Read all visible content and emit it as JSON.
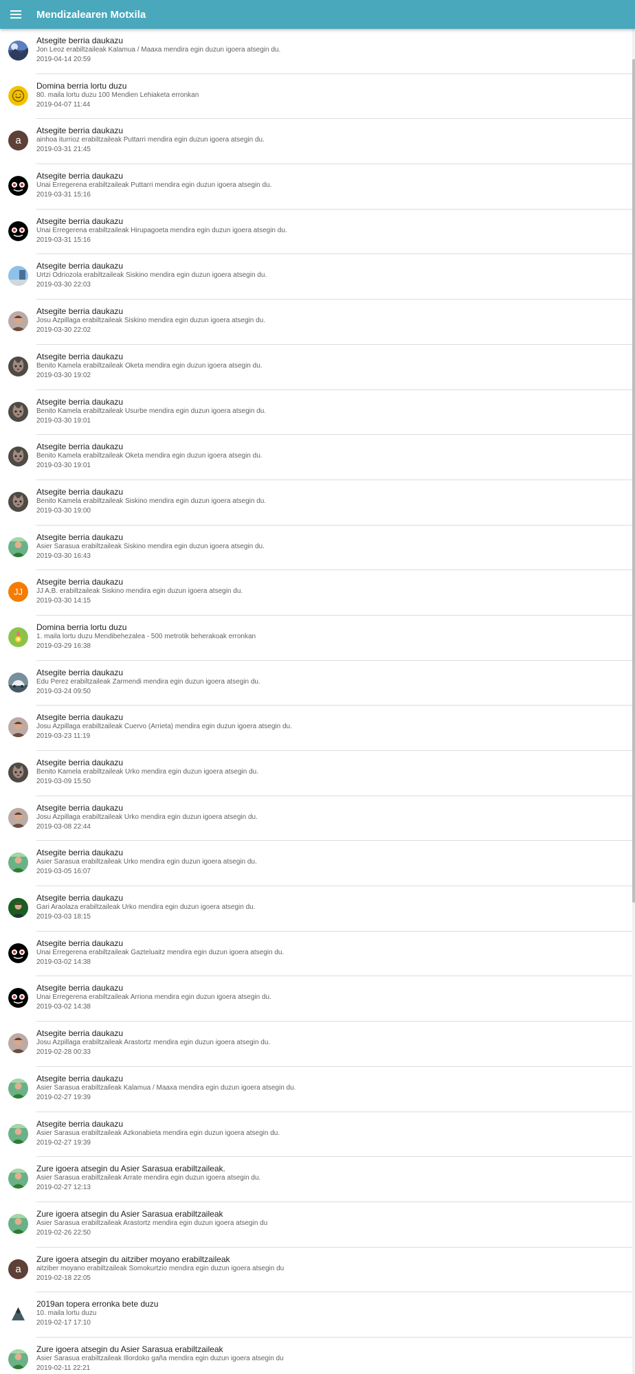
{
  "app": {
    "title": "Mendizalearen Motxila",
    "menu_icon": "hamburger-menu-icon",
    "header_color": "#4aa8bd"
  },
  "notifications": [
    {
      "title": "Atsegite berria daukazu",
      "desc": "Jon Leoz erabiltzaileak Kalamua / Maaxa mendira egin duzun igoera atsegin du.",
      "date": "2019-04-14 20:59",
      "avatar": "landscape-photo-avatar-icon"
    },
    {
      "title": "Domina berria lortu duzu",
      "desc": "80. maila lortu duzu 100 Mendien Lehiaketa erronkan",
      "date": "2019-04-07 11:44",
      "avatar": "medal-gold-icon"
    },
    {
      "title": "Atsegite berria daukazu",
      "desc": "ainhoa iturrioz erabiltzaileak Puttarri mendira egin duzun igoera atsegin du.",
      "date": "2019-03-31 21:45",
      "avatar": "letter-avatar-icon",
      "avatar_letter": "a",
      "avatar_color": "#5d4037"
    },
    {
      "title": "Atsegite berria daukazu",
      "desc": "Unai Erregerena erabiltzaileak Puttarri mendira egin duzun igoera atsegin du.",
      "date": "2019-03-31 15:16",
      "avatar": "cartoon-photo-avatar-icon"
    },
    {
      "title": "Atsegite berria daukazu",
      "desc": "Unai Erregerena erabiltzaileak Hirupagoeta mendira egin duzun igoera atsegin du.",
      "date": "2019-03-31 15:16",
      "avatar": "cartoon-photo-avatar-icon"
    },
    {
      "title": "Atsegite berria daukazu",
      "desc": "Urtzi Odriozola erabiltzaileak Siskino mendira egin duzun igoera atsegin du.",
      "date": "2019-03-30 22:03",
      "avatar": "sky-photo-avatar-icon"
    },
    {
      "title": "Atsegite berria daukazu",
      "desc": "Josu Azpillaga erabiltzaileak Siskino mendira egin duzun igoera atsegin du.",
      "date": "2019-03-30 22:02",
      "avatar": "person-photo-avatar-icon"
    },
    {
      "title": "Atsegite berria daukazu",
      "desc": "Benito Kamela erabiltzaileak Oketa mendira egin duzun igoera atsegin du.",
      "date": "2019-03-30 19:02",
      "avatar": "cat-photo-avatar-icon"
    },
    {
      "title": "Atsegite berria daukazu",
      "desc": "Benito Kamela erabiltzaileak Usurbe mendira egin duzun igoera atsegin du.",
      "date": "2019-03-30 19:01",
      "avatar": "cat-photo-avatar-icon"
    },
    {
      "title": "Atsegite berria daukazu",
      "desc": "Benito Kamela erabiltzaileak Oketa mendira egin duzun igoera atsegin du.",
      "date": "2019-03-30 19:01",
      "avatar": "cat-photo-avatar-icon"
    },
    {
      "title": "Atsegite berria daukazu",
      "desc": "Benito Kamela erabiltzaileak Siskino mendira egin duzun igoera atsegin du.",
      "date": "2019-03-30 19:00",
      "avatar": "cat-photo-avatar-icon"
    },
    {
      "title": "Atsegite berria daukazu",
      "desc": "Asier Sarasua erabiltzaileak Siskino mendira egin duzun igoera atsegin du.",
      "date": "2019-03-30 16:43",
      "avatar": "outdoor-person-avatar-icon"
    },
    {
      "title": "Atsegite berria daukazu",
      "desc": "JJ A.B. erabiltzaileak Siskino mendira egin duzun igoera atsegin du.",
      "date": "2019-03-30 14:15",
      "avatar": "letter-avatar-icon",
      "avatar_letter": "JJ",
      "avatar_color": "#f57c00"
    },
    {
      "title": "Domina berria lortu duzu",
      "desc": "1. maila lortu duzu Mendibehezalea - 500 metrotik beherakoak erronkan",
      "date": "2019-03-29 16:38",
      "avatar": "medal-green-icon"
    },
    {
      "title": "Atsegite berria daukazu",
      "desc": "Edu Perez erabiltzaileak Zarmendi mendira egin duzun igoera atsegin du.",
      "date": "2019-03-24 09:50",
      "avatar": "car-photo-avatar-icon"
    },
    {
      "title": "Atsegite berria daukazu",
      "desc": "Josu Azpillaga erabiltzaileak Cuervo (Arrieta) mendira egin duzun igoera atsegin du.",
      "date": "2019-03-23 11:19",
      "avatar": "person-photo-avatar-icon"
    },
    {
      "title": "Atsegite berria daukazu",
      "desc": "Benito Kamela erabiltzaileak Urko mendira egin duzun igoera atsegin du.",
      "date": "2019-03-09 15:50",
      "avatar": "cat-photo-avatar-icon"
    },
    {
      "title": "Atsegite berria daukazu",
      "desc": "Josu Azpillaga erabiltzaileak Urko mendira egin duzun igoera atsegin du.",
      "date": "2019-03-08 22:44",
      "avatar": "person-photo-avatar-icon"
    },
    {
      "title": "Atsegite berria daukazu",
      "desc": "Asier Sarasua erabiltzaileak Urko mendira egin duzun igoera atsegin du.",
      "date": "2019-03-05 16:07",
      "avatar": "outdoor-person-avatar-icon"
    },
    {
      "title": "Atsegite berria daukazu",
      "desc": "Gari Araolaza erabiltzaileak Urko mendira egin duzun igoera atsegin du.",
      "date": "2019-03-03 18:15",
      "avatar": "forest-person-avatar-icon"
    },
    {
      "title": "Atsegite berria daukazu",
      "desc": "Unai Erregerena erabiltzaileak Gazteluaitz mendira egin duzun igoera atsegin du.",
      "date": "2019-03-02 14:38",
      "avatar": "cartoon-photo-avatar-icon"
    },
    {
      "title": "Atsegite berria daukazu",
      "desc": "Unai Erregerena erabiltzaileak Arriona mendira egin duzun igoera atsegin du.",
      "date": "2019-03-02 14:38",
      "avatar": "cartoon-photo-avatar-icon"
    },
    {
      "title": "Atsegite berria daukazu",
      "desc": "Josu Azpillaga erabiltzaileak Arastortz mendira egin duzun igoera atsegin du.",
      "date": "2019-02-28 00:33",
      "avatar": "person-photo-avatar-icon"
    },
    {
      "title": "Atsegite berria daukazu",
      "desc": "Asier Sarasua erabiltzaileak Kalamua / Maaxa mendira egin duzun igoera atsegin du.",
      "date": "2019-02-27 19:39",
      "avatar": "outdoor-person-avatar-icon"
    },
    {
      "title": "Atsegite berria daukazu",
      "desc": "Asier Sarasua erabiltzaileak Azkonabieta mendira egin duzun igoera atsegin du.",
      "date": "2019-02-27 19:39",
      "avatar": "outdoor-person-avatar-icon"
    },
    {
      "title": "Zure igoera atsegin du Asier Sarasua erabiltzaileak.",
      "desc": "Asier Sarasua erabiltzaileak Arrate mendira egin duzun igoera atsegin du.",
      "date": "2019-02-27 12:13",
      "avatar": "outdoor-person-avatar-icon"
    },
    {
      "title": "Zure igoera atsegin du Asier Sarasua erabiltzaileak",
      "desc": "Asier Sarasua erabiltzaileak Arastortz mendira egin duzun igoera atsegin du",
      "date": "2019-02-26 22:50",
      "avatar": "outdoor-person-avatar-icon"
    },
    {
      "title": "Zure igoera atsegin du aitziber moyano erabiltzaileak",
      "desc": "aitziber moyano erabiltzaileak Somokurtzio mendira egin duzun igoera atsegin du",
      "date": "2019-02-18 22:05",
      "avatar": "letter-avatar-icon",
      "avatar_letter": "a",
      "avatar_color": "#5d4037"
    },
    {
      "title": "2019an topera erronka bete duzu",
      "desc": "10. maila lortu duzu",
      "date": "2019-02-17 17:10",
      "avatar": "mountain-icon"
    },
    {
      "title": "Zure igoera atsegin du Asier Sarasua erabiltzaileak",
      "desc": "Asier Sarasua erabiltzaileak Illordoko gaña mendira egin duzun igoera atsegin du",
      "date": "2019-02-11 22:21",
      "avatar": "outdoor-person-avatar-icon"
    }
  ]
}
